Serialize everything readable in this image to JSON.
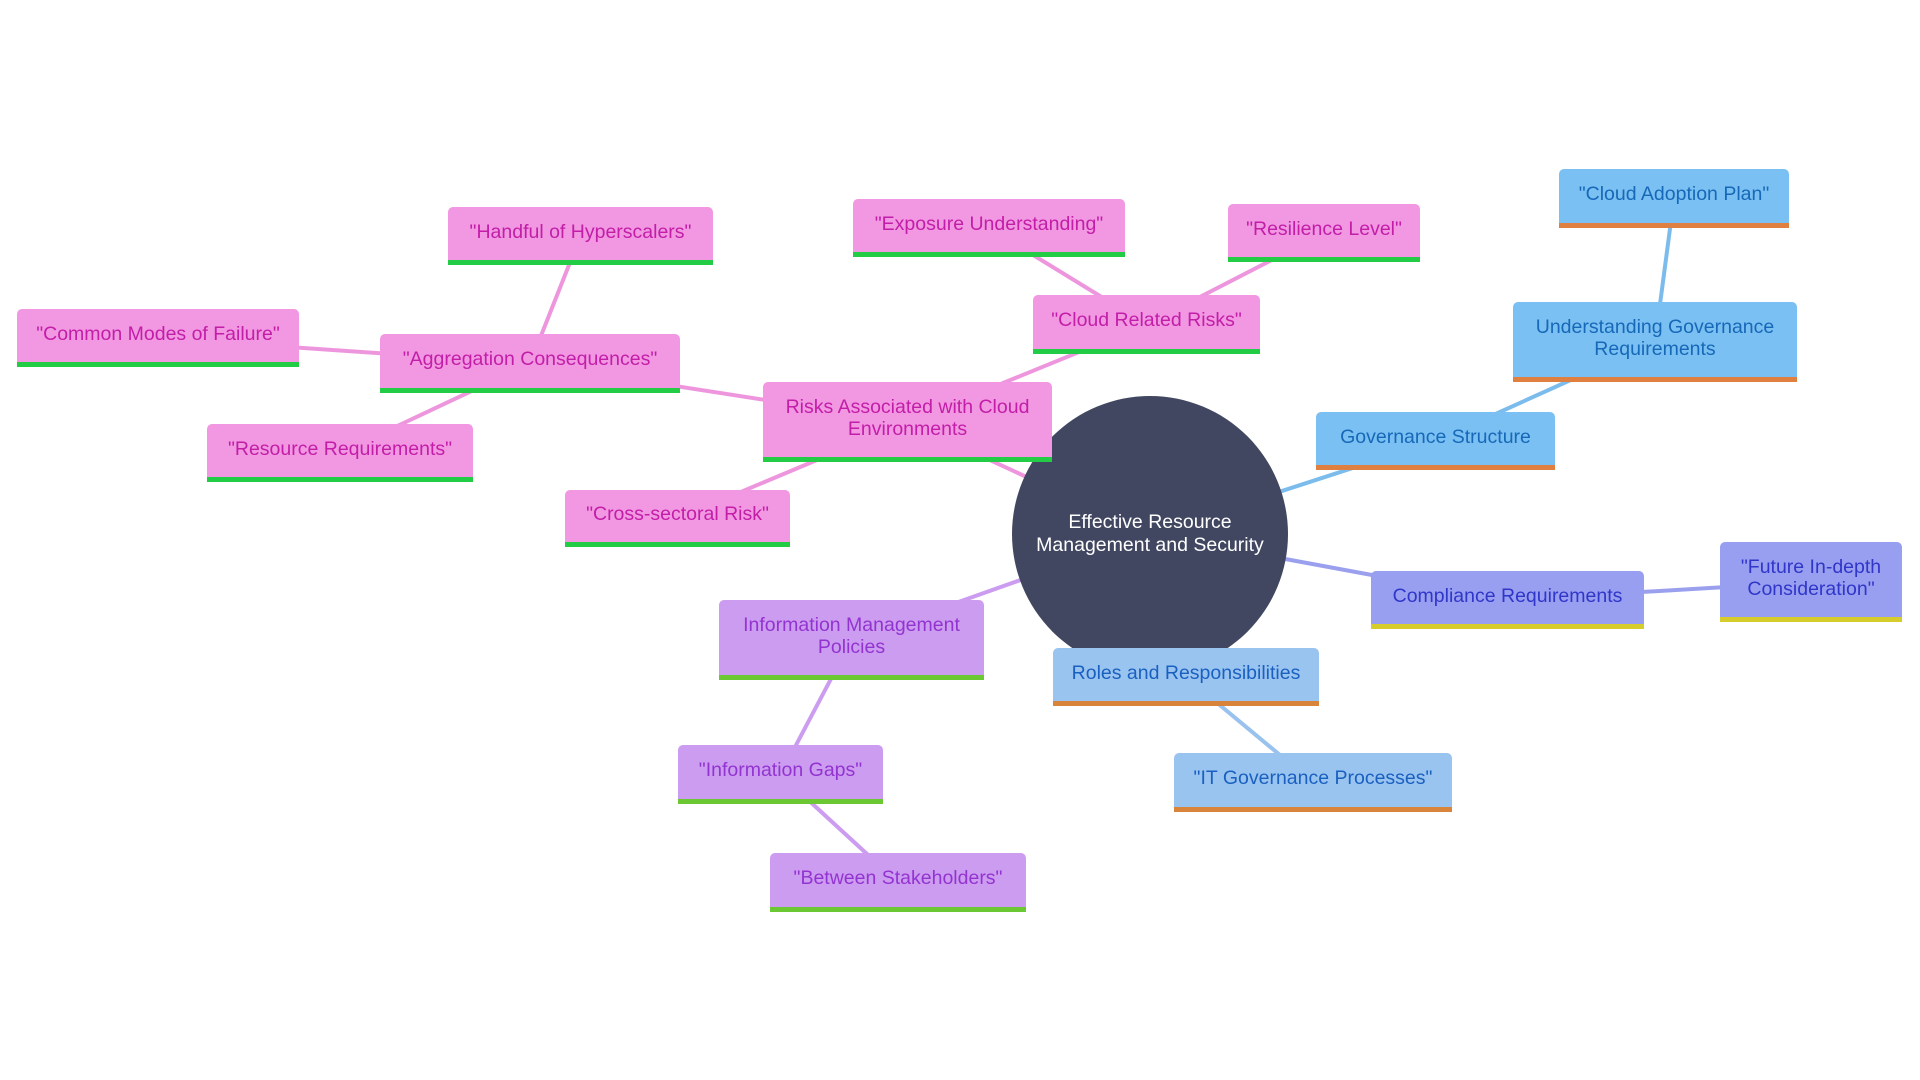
{
  "diagram": {
    "type": "mindmap",
    "colors": {
      "root_fill": "#414760",
      "root_text": "#ffffff",
      "risk_branch": "#f297e2",
      "governance_branch": "#7bc0f2",
      "roles_branch": "#9ac4f0",
      "compliance_branch": "#989ff0",
      "information_branch": "#cc9cf0"
    },
    "root": "Effective Resource Management and Security",
    "nodes": {
      "risks": "Risks Associated with Cloud Environments",
      "cloud_related_risks": "\"Cloud Related Risks\"",
      "exposure_understanding": "\"Exposure Understanding\"",
      "resilience_level": "\"Resilience Level\"",
      "aggregation_consequences": "\"Aggregation Consequences\"",
      "handful_of_hyperscalers": "\"Handful of Hyperscalers\"",
      "common_modes_of_failure": "\"Common Modes of Failure\"",
      "resource_requirements": "\"Resource Requirements\"",
      "cross_sectoral_risk": "\"Cross-sectoral Risk\"",
      "governance_structure": "Governance Structure",
      "understanding_governance": "Understanding Governance Requirements",
      "cloud_adoption_plan": "\"Cloud Adoption Plan\"",
      "compliance_requirements": "Compliance Requirements",
      "future_consideration": "\"Future In-depth Consideration\"",
      "roles_responsibilities": "Roles and Responsibilities",
      "it_governance_processes": "\"IT Governance Processes\"",
      "information_management": "Information Management Policies",
      "information_gaps": "\"Information Gaps\"",
      "between_stakeholders": "\"Between Stakeholders\""
    },
    "edges": [
      [
        "root",
        "risks"
      ],
      [
        "risks",
        "cloud_related_risks"
      ],
      [
        "cloud_related_risks",
        "exposure_understanding"
      ],
      [
        "cloud_related_risks",
        "resilience_level"
      ],
      [
        "risks",
        "aggregation_consequences"
      ],
      [
        "aggregation_consequences",
        "handful_of_hyperscalers"
      ],
      [
        "aggregation_consequences",
        "common_modes_of_failure"
      ],
      [
        "aggregation_consequences",
        "resource_requirements"
      ],
      [
        "risks",
        "cross_sectoral_risk"
      ],
      [
        "root",
        "governance_structure"
      ],
      [
        "governance_structure",
        "understanding_governance"
      ],
      [
        "understanding_governance",
        "cloud_adoption_plan"
      ],
      [
        "root",
        "compliance_requirements"
      ],
      [
        "compliance_requirements",
        "future_consideration"
      ],
      [
        "root",
        "roles_responsibilities"
      ],
      [
        "roles_responsibilities",
        "it_governance_processes"
      ],
      [
        "root",
        "information_management"
      ],
      [
        "information_management",
        "information_gaps"
      ],
      [
        "information_gaps",
        "between_stakeholders"
      ]
    ]
  }
}
